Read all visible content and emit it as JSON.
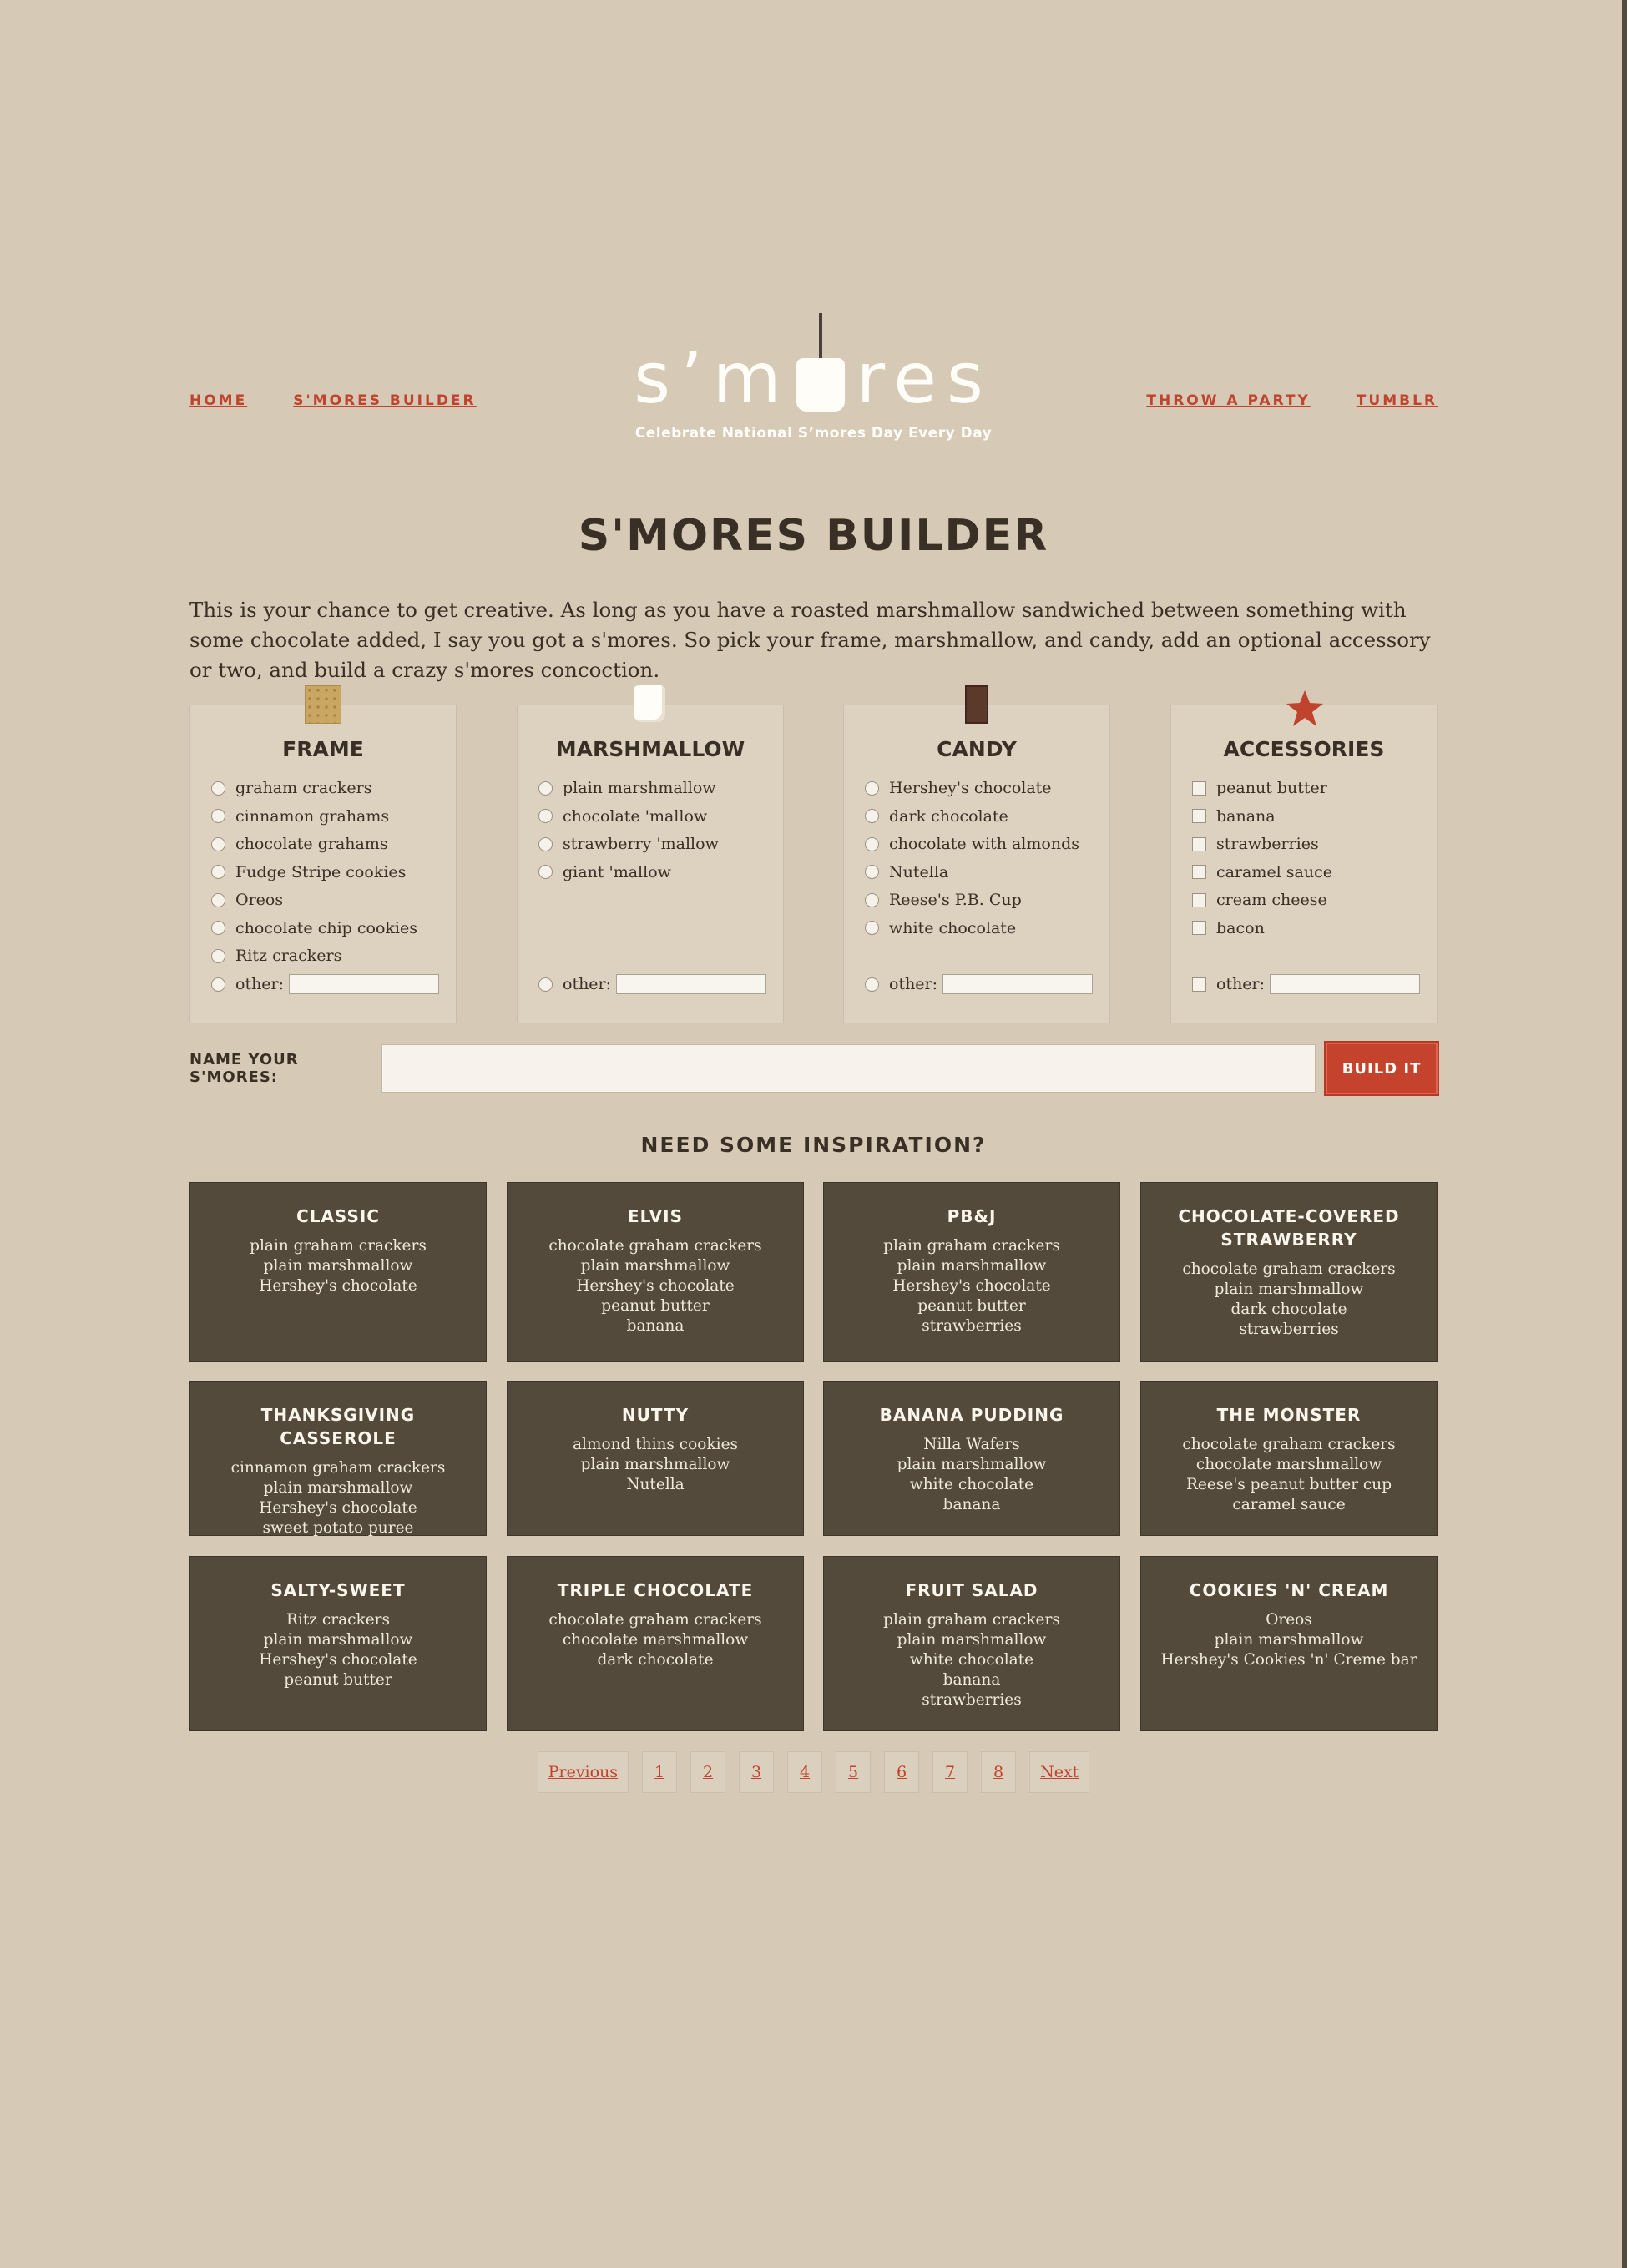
{
  "nav": {
    "left": [
      {
        "label": "HOME"
      },
      {
        "label": "S'MORES BUILDER"
      }
    ],
    "right": [
      {
        "label": "THROW A PARTY"
      },
      {
        "label": "TUMBLR"
      }
    ]
  },
  "logo": {
    "left": "s’m",
    "right": "res",
    "tagline": "Celebrate National S’mores Day Every Day"
  },
  "page_title": "S'MORES BUILDER",
  "intro": "This is your chance to get creative. As long as you have a roasted marshmallow sandwiched between something with some chocolate added, I say you got a s'mores. So pick your frame, marshmallow, and candy, add an optional accessory or two, and build a crazy s'mores concoction.",
  "builder": {
    "frame": {
      "title": "FRAME",
      "icon": "graham-cracker-icon",
      "options": [
        "graham crackers",
        "cinnamon grahams",
        "chocolate grahams",
        "Fudge Stripe cookies",
        "Oreos",
        "chocolate chip cookies",
        "Ritz crackers"
      ],
      "other_label": "other:"
    },
    "marshmallow": {
      "title": "MARSHMALLOW",
      "icon": "marshmallow-icon",
      "options": [
        "plain marshmallow",
        "chocolate 'mallow",
        "strawberry 'mallow",
        "giant 'mallow"
      ],
      "other_label": "other:"
    },
    "candy": {
      "title": "CANDY",
      "icon": "chocolate-bar-icon",
      "options": [
        "Hershey's chocolate",
        "dark chocolate",
        "chocolate with almonds",
        "Nutella",
        "Reese's P.B. Cup",
        "white chocolate"
      ],
      "other_label": "other:"
    },
    "accessories": {
      "title": "ACCESSORIES",
      "icon": "star-icon",
      "options": [
        "peanut butter",
        "banana",
        "strawberries",
        "caramel sauce",
        "cream cheese",
        "bacon"
      ],
      "other_label": "other:"
    }
  },
  "name_row": {
    "label": "NAME YOUR S'MORES:",
    "value": "",
    "placeholder": "",
    "button": "BUILD IT"
  },
  "inspiration_title": "NEED SOME INSPIRATION?",
  "recipes": [
    {
      "title": "CLASSIC",
      "ingredients": [
        "plain graham crackers",
        "plain marshmallow",
        "Hershey's chocolate"
      ]
    },
    {
      "title": "ELVIS",
      "ingredients": [
        "chocolate graham crackers",
        "plain marshmallow",
        "Hershey's chocolate",
        "peanut butter",
        "banana"
      ]
    },
    {
      "title": "PB&J",
      "ingredients": [
        "plain graham crackers",
        "plain marshmallow",
        "Hershey's chocolate",
        "peanut butter",
        "strawberries"
      ]
    },
    {
      "title": "CHOCOLATE-COVERED STRAWBERRY",
      "ingredients": [
        "chocolate graham crackers",
        "plain marshmallow",
        "dark chocolate",
        "strawberries"
      ]
    },
    {
      "title": "THANKSGIVING CASSEROLE",
      "ingredients": [
        "cinnamon graham crackers",
        "plain marshmallow",
        "Hershey's chocolate",
        "sweet potato puree"
      ]
    },
    {
      "title": "NUTTY",
      "ingredients": [
        "almond thins cookies",
        "plain marshmallow",
        "Nutella"
      ]
    },
    {
      "title": "BANANA PUDDING",
      "ingredients": [
        "Nilla Wafers",
        "plain marshmallow",
        "white chocolate",
        "banana"
      ]
    },
    {
      "title": "THE MONSTER",
      "ingredients": [
        "chocolate graham crackers",
        "chocolate marshmallow",
        "Reese's peanut butter cup",
        "caramel sauce"
      ]
    },
    {
      "title": "SALTY-SWEET",
      "ingredients": [
        "Ritz crackers",
        "plain marshmallow",
        "Hershey's chocolate",
        "peanut butter"
      ]
    },
    {
      "title": "TRIPLE CHOCOLATE",
      "ingredients": [
        "chocolate graham crackers",
        "chocolate marshmallow",
        "dark chocolate"
      ]
    },
    {
      "title": "FRUIT SALAD",
      "ingredients": [
        "plain graham crackers",
        "plain marshmallow",
        "white chocolate",
        "banana",
        "strawberries"
      ]
    },
    {
      "title": "COOKIES 'N' CREAM",
      "ingredients": [
        "Oreos",
        "plain marshmallow",
        "Hershey's Cookies 'n' Creme bar"
      ]
    }
  ],
  "pagination": {
    "previous": "Previous",
    "pages": [
      "1",
      "2",
      "3",
      "4",
      "5",
      "6",
      "7",
      "8"
    ],
    "next": "Next"
  },
  "colors": {
    "background": "#d6c9b5",
    "accent": "#c0432d",
    "card": "#544a3c",
    "text": "#3a2f24"
  }
}
